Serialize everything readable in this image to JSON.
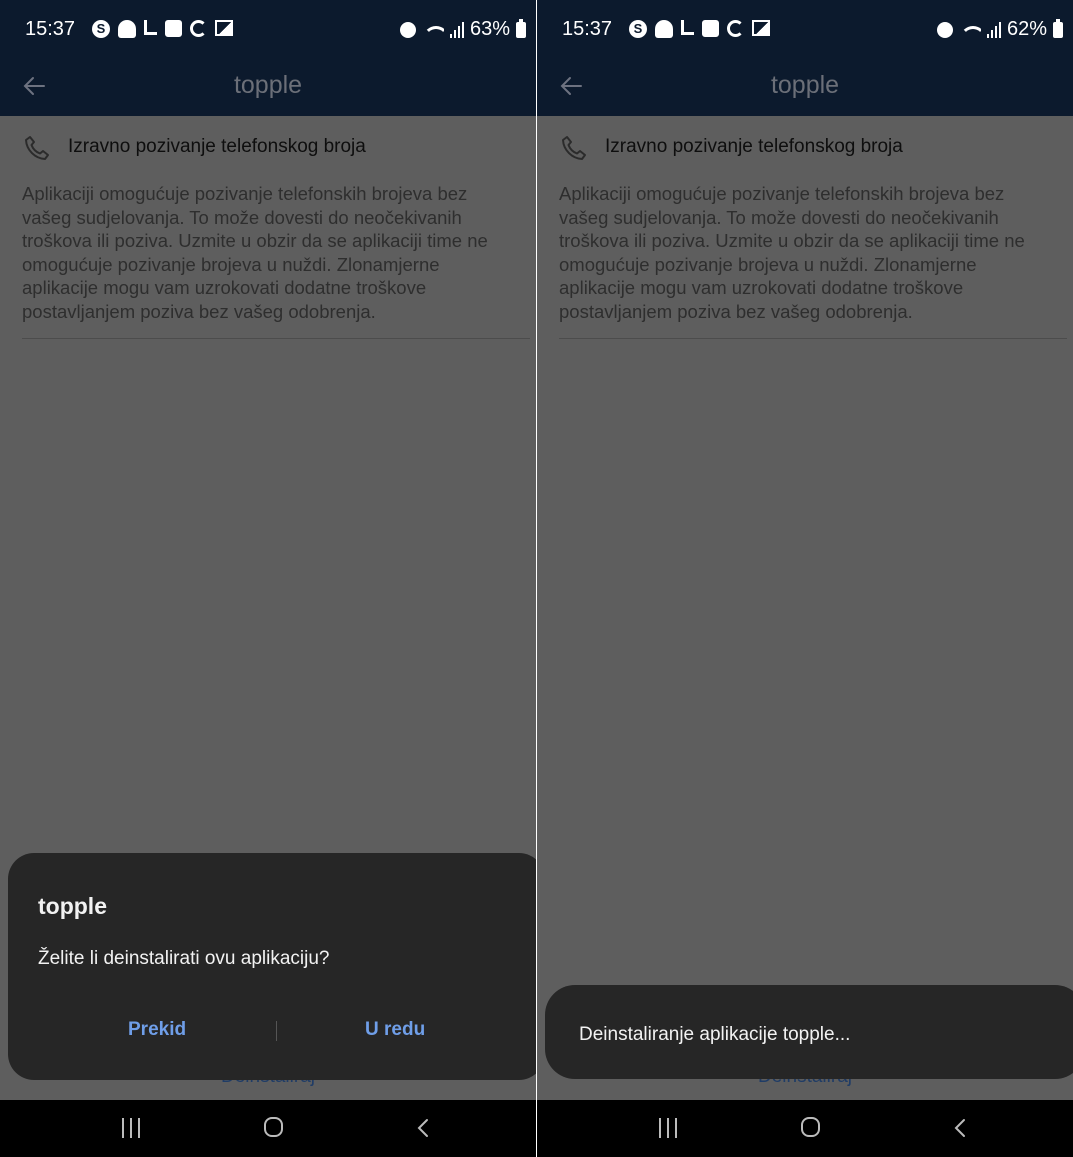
{
  "screens": [
    {
      "status": {
        "time": "15:37",
        "battery": "63%"
      },
      "app_bar": {
        "title": "topple"
      },
      "permission": {
        "title": "Izravno pozivanje telefonskog broja",
        "description": "Aplikaciji omogućuje pozivanje telefonskih brojeva bez vašeg sudjelovanja. To može dovesti do neočekivanih troškova ili poziva. Uzmite u obzir da se aplikaciji time ne omogućuje pozivanje brojeva u nuždi. Zlonamjerne aplikacije mogu vam uzrokovati dodatne troškove postavljanjem poziva bez vašeg odobrenja."
      },
      "uninstall_label": "Deinstaliraj",
      "dialog": {
        "title": "topple",
        "message": "Želite li deinstalirati ovu aplikaciju?",
        "cancel_label": "Prekid",
        "ok_label": "U redu"
      }
    },
    {
      "status": {
        "time": "15:37",
        "battery": "62%"
      },
      "app_bar": {
        "title": "topple"
      },
      "permission": {
        "title": "Izravno pozivanje telefonskog broja",
        "description": "Aplikaciji omogućuje pozivanje telefonskih brojeva bez vašeg sudjelovanja. To može dovesti do neočekivanih troškova ili poziva. Uzmite u obzir da se aplikaciji time ne omogućuje pozivanje brojeva u nuždi. Zlonamjerne aplikacije mogu vam uzrokovati dodatne troškove postavljanjem poziva bez vašeg odobrenja."
      },
      "uninstall_label": "Deinstaliraj",
      "toast": {
        "text": "Deinstaliranje aplikacije topple..."
      }
    }
  ],
  "colors": {
    "app_bar": "#0c1a2d",
    "dimmed_background": "#5e5e5e",
    "dialog_background": "#262626",
    "accent": "#6f9ee8"
  },
  "icons": [
    "s-app-icon",
    "person-icon",
    "download-icon",
    "check-icon",
    "sync-icon",
    "image-icon",
    "alarm-icon",
    "wifi-icon",
    "signal-icon",
    "battery-icon",
    "back-arrow-icon",
    "phone-icon",
    "recents-icon",
    "home-icon",
    "nav-back-icon"
  ]
}
